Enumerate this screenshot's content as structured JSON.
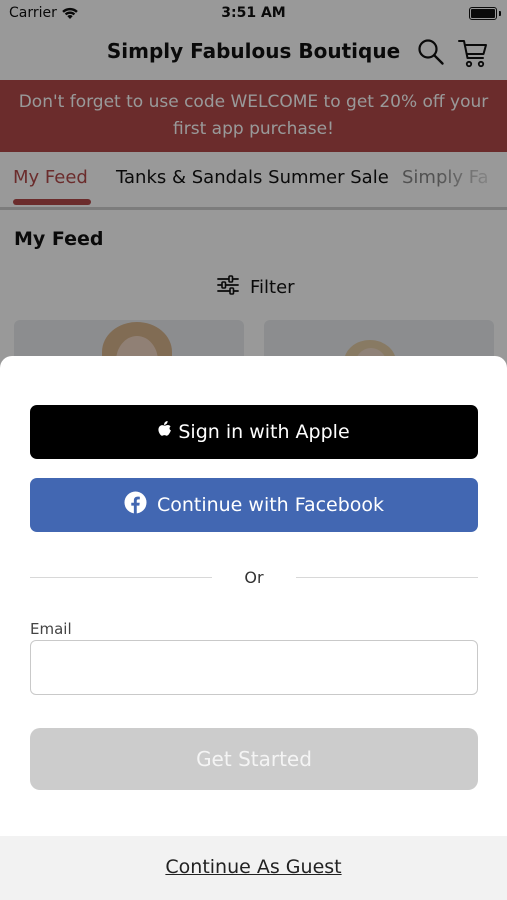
{
  "status_bar": {
    "carrier": "Carrier",
    "time": "3:51 AM"
  },
  "header": {
    "title": "Simply Fabulous Boutique",
    "search_icon": "search-icon",
    "cart_icon": "cart-icon"
  },
  "promo_banner": {
    "text": "Don't forget to use code WELCOME to get 20% off your first app purchase!",
    "color": "#b34a4a"
  },
  "tabs": [
    {
      "label": "My Feed",
      "active": true
    },
    {
      "label": "Tanks & Sandals Summer Sale",
      "active": false
    },
    {
      "label": "Simply Fa",
      "active": false
    }
  ],
  "feed": {
    "title": "My Feed",
    "filter_label": "Filter",
    "filter_icon": "sliders-icon"
  },
  "sign_in_sheet": {
    "apple_button": "Sign in with Apple",
    "facebook_button": "Continue with Facebook",
    "divider_text": "Or",
    "email_label": "Email",
    "email_value": "",
    "email_placeholder": "",
    "get_started_button": "Get Started",
    "guest_link": "Continue As Guest"
  },
  "colors": {
    "accent": "#b34a4a",
    "apple_button": "#000000",
    "facebook_button": "#4267b2",
    "get_started_disabled": "#cccccc"
  }
}
